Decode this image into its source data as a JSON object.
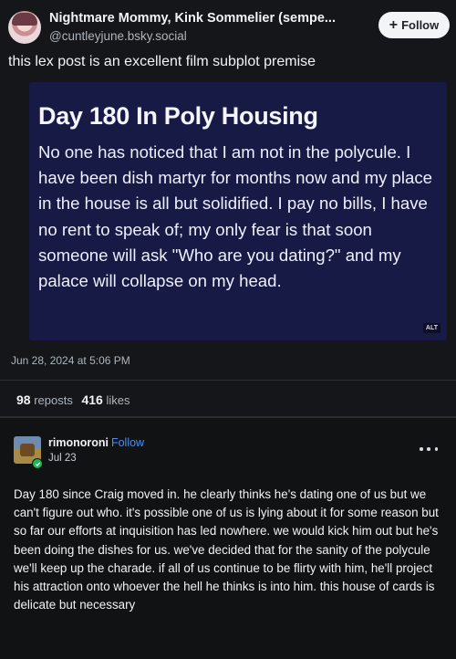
{
  "bluesky_post": {
    "author": {
      "display_name": "Nightmare Mommy, Kink Sommelier (sempe...",
      "handle": "@cuntleyjune.bsky.social",
      "avatar_icon": "user-avatar-icon"
    },
    "follow_button": {
      "label": "Follow",
      "icon": "plus-icon"
    },
    "text": "this lex post is an excellent film subplot premise",
    "embedded_image": {
      "title": "Day 180 In Poly Housing",
      "body": "No one has noticed that I am not in the polycule. I have been dish martyr for months now and my place in the house is all but solidified. I pay no bills, I have no rent to speak of; my only fear is that soon someone will ask \"Who are you dating?\" and my palace will collapse on my head.",
      "alt_badge": "ALT",
      "background_color": "#161a45"
    },
    "timestamp": "Jun 28, 2024 at 5:06 PM",
    "stats": {
      "reposts_count": "98",
      "reposts_label": "reposts",
      "likes_count": "416",
      "likes_label": "likes"
    }
  },
  "tumblr_post": {
    "username": "rimonoroni",
    "follow_label": "Follow",
    "date": "Jul 23",
    "more_icon": "more-dots-icon",
    "text": "Day 180 since Craig moved in. he clearly thinks he's dating one of us but we can't figure out who. it's possible one of us is lying about it for some reason but so far our efforts at inquisition has led nowhere. we would kick him out but he's been doing the dishes for us. we've decided that for the sanity of the polycule we'll keep up the charade. if all of us continue to be flirty with him, he'll project his attraction onto whoever the hell he thinks is into him. this house of cards is delicate but necessary"
  },
  "colors": {
    "background": "#101214",
    "accent_link": "#4d8ff0",
    "verified_badge": "#1fb45a"
  }
}
